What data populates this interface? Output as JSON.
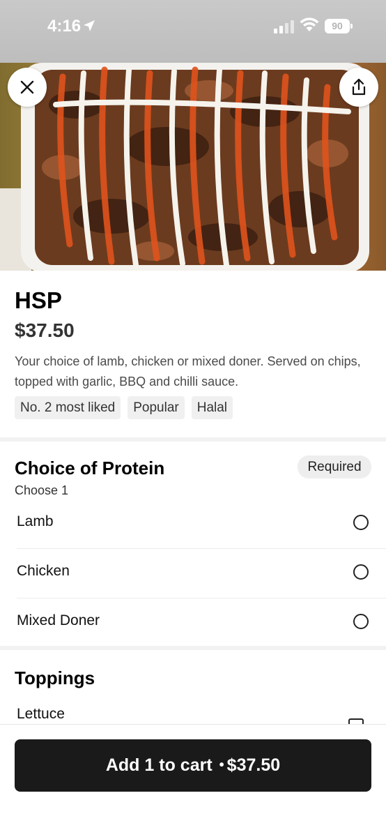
{
  "status_bar": {
    "time": "4:16",
    "battery": "90"
  },
  "hero": {
    "image_alt": "food",
    "close_icon": "close-icon",
    "share_icon": "share-icon"
  },
  "item": {
    "title": "HSP",
    "price": "$37.50",
    "description": "Your choice of lamb, chicken or mixed doner. Served on chips, topped with garlic, BBQ and chilli sauce.",
    "tags": [
      "No. 2 most liked",
      "Popular",
      "Halal"
    ]
  },
  "protein": {
    "title": "Choice of Protein",
    "subtitle": "Choose 1",
    "required_label": "Required",
    "options": [
      "Lamb",
      "Chicken",
      "Mixed Doner"
    ]
  },
  "toppings": {
    "title": "Toppings",
    "options": [
      "Lettuce"
    ]
  },
  "cart": {
    "label": "Add 1 to cart",
    "separator": "•",
    "price": "$37.50"
  }
}
